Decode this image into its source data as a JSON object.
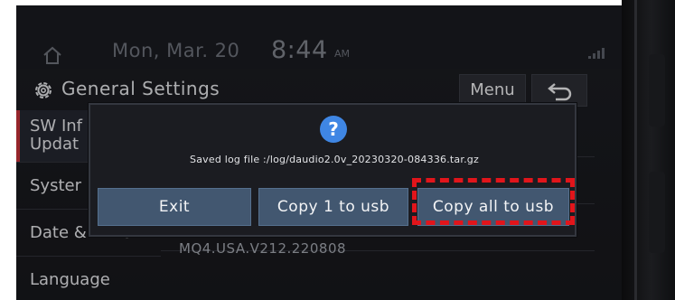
{
  "status_bar": {
    "date": "Mon, Mar. 20",
    "time": "8:44",
    "ampm": "AM",
    "home_icon": "home-icon",
    "signal_icon": "signal-icon"
  },
  "header": {
    "title": "General Settings",
    "menu_label": "Menu",
    "gear_icon": "gear-icon",
    "back_icon": "back-icon"
  },
  "sidebar": {
    "items": [
      {
        "label_line1": "SW Inf",
        "label_line2": "Updat"
      },
      {
        "label": "Syster"
      },
      {
        "label": "Date & Time"
      },
      {
        "label": "Language"
      }
    ]
  },
  "content": {
    "version": "MQ4.USA.V212.220808"
  },
  "dialog": {
    "icon_text": "?",
    "info_icon": "info-icon",
    "message": "Saved log file :/log/daudio2.0v_20230320-084336.tar.gz",
    "buttons": {
      "exit": "Exit",
      "copy_one": "Copy 1 to usb",
      "copy_all": "Copy all to usb"
    }
  },
  "colors": {
    "screen_bg": "#1c1d22",
    "button_bg": "#425770",
    "accent_red": "#c8323a",
    "highlight_red": "#e1151b",
    "info_blue": "#3f86e4"
  }
}
